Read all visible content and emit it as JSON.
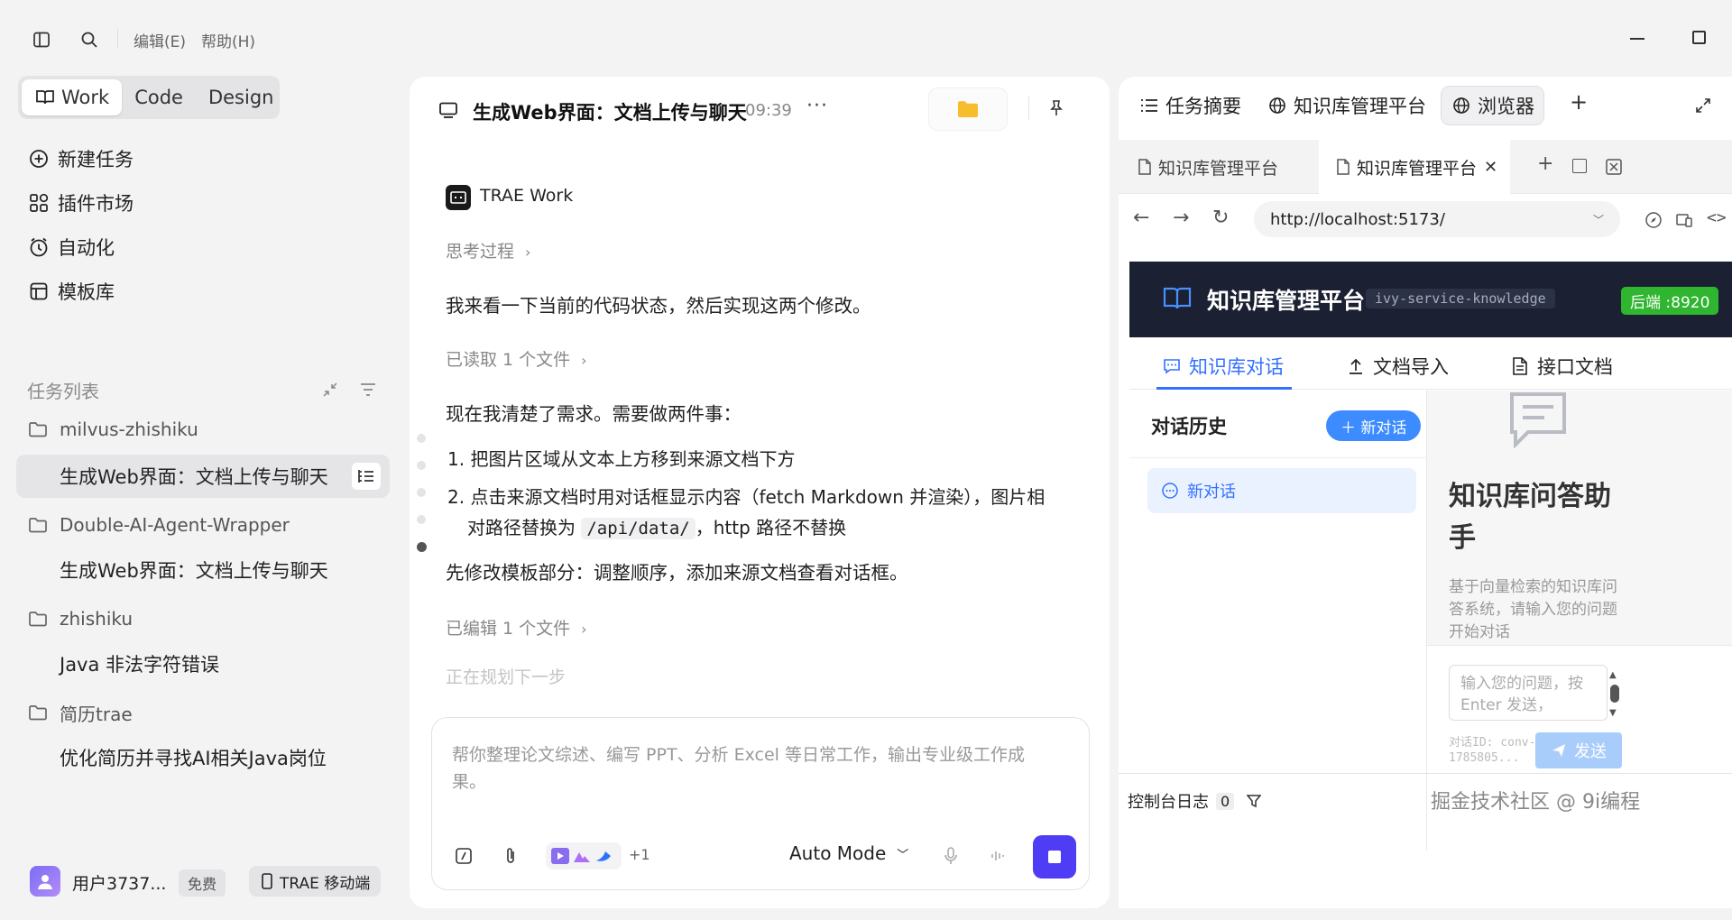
{
  "menu": {
    "edit": "编辑(E)",
    "help": "帮助(H)"
  },
  "modes": [
    "Work",
    "Code",
    "Design"
  ],
  "nav": [
    "新建任务",
    "插件市场",
    "自动化",
    "模板库"
  ],
  "task_list": {
    "title": "任务列表",
    "groups": [
      {
        "folder": "milvus-zhishiku",
        "tasks": [
          "生成Web界面：文档上传与聊天"
        ]
      },
      {
        "folder": "Double-AI-Agent-Wrapper",
        "tasks": [
          "生成Web界面：文档上传与聊天"
        ]
      },
      {
        "folder": "zhishiku",
        "tasks": [
          "Java 非法字符错误"
        ]
      },
      {
        "folder": "简历trae",
        "tasks": [
          "优化简历并寻找AI相关Java岗位"
        ]
      }
    ]
  },
  "user": {
    "name": "用户3737...",
    "plan": "免费",
    "mobile": "TRAE 移动端"
  },
  "chat": {
    "title": "生成Web界面：文档上传与聊天",
    "time": "09:39",
    "agent": "TRAE Work",
    "thinking": "思考过程",
    "msg1": "我来看一下当前的代码状态，然后实现这两个修改。",
    "read": "已读取 1 个文件",
    "msg2": "现在我清楚了需求。需要做两件事：",
    "item1": "1. 把图片区域从文本上方移到来源文档下方",
    "item2a": "2. 点击来源文档时用对话框显示内容（fetch Markdown 并渲染），图片相",
    "item2b_pre": "对路径替换为",
    "item2b_code": "/api/data/",
    "item2b_post": "，http 路径不替换",
    "msg3": "先修改模板部分：调整顺序，添加来源文档查看对话框。",
    "edited": "已编辑 1 个文件",
    "planning": "正在规划下一步",
    "input_placeholder": "帮你整理论文综述、编写 PPT、分析 Excel 等日常工作，输出专业级工作成果。",
    "plus_count": "+1",
    "mode": "Auto Mode"
  },
  "right": {
    "tabs": [
      "任务摘要",
      "知识库管理平台",
      "浏览器"
    ],
    "browser_tabs": [
      "知识库管理平台",
      "知识库管理平台"
    ],
    "url": "http://localhost:5173/",
    "app": {
      "title": "知识库管理平台",
      "service": "ivy-service-knowledge",
      "backend": "后端 :8920",
      "tabs": [
        "知识库对话",
        "文档导入",
        "接口文档"
      ],
      "history_title": "对话历史",
      "new_chat_btn": "＋ 新对话",
      "conv_item": "新对话",
      "assistant_title_1": "知识库问答助",
      "assistant_title_2": "手",
      "desc": [
        "基于向量检索的知识库问",
        "答系统，请输入您的问题",
        "开始对话"
      ],
      "input_placeholder": "输入您的问题，按 Enter 发送，",
      "conv_id_1": "对话ID: conv-",
      "conv_id_2": "1785805...",
      "send": "发送"
    },
    "console": "控制台日志",
    "console_count": "0",
    "watermark": "掘金技术社区 @ 9i编程"
  },
  "colors": {
    "accent": "#3370ff",
    "stop_btn": "#4e3df5",
    "app_header": "#1b2032",
    "backend_badge": "#2fb52f"
  }
}
